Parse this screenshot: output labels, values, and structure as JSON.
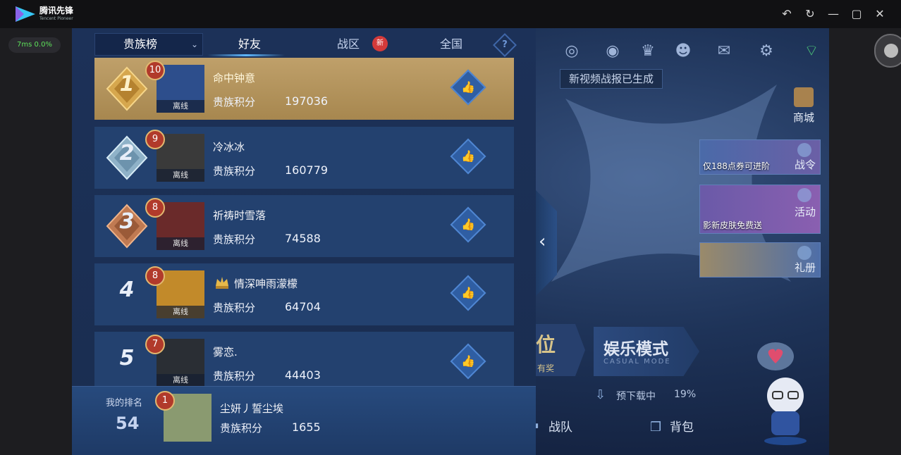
{
  "app": {
    "name": "腾讯先锋",
    "subtitle": "Tencent Pioneer"
  },
  "window_controls": {
    "back": "↶",
    "refresh": "↻",
    "minimize": "—",
    "maximize": "▢",
    "close": "✕"
  },
  "perf": {
    "text": "7ms  0.0%"
  },
  "tabs": {
    "dropdown": "贵族榜",
    "chevron": "⌄",
    "friends": "好友",
    "zone": "战区",
    "zone_badge": "新",
    "nation": "全国",
    "help": "?"
  },
  "leaderboard": {
    "rows": [
      {
        "rank": "1",
        "level": "10",
        "name": "命中钟意",
        "status": "离线",
        "score_label": "贵族积分",
        "score": "197036"
      },
      {
        "rank": "2",
        "level": "9",
        "name": "冷冰冰",
        "status": "离线",
        "score_label": "贵族积分",
        "score": "160779"
      },
      {
        "rank": "3",
        "level": "8",
        "name": "祈祷时雪落",
        "status": "离线",
        "score_label": "贵族积分",
        "score": "74588"
      },
      {
        "rank": "4",
        "level": "8",
        "name": "情深呻雨濛檬",
        "status": "离线",
        "score_label": "贵族积分",
        "score": "64704"
      },
      {
        "rank": "5",
        "level": "7",
        "name": "雾恋.",
        "status": "离线",
        "score_label": "贵族积分",
        "score": "44403"
      }
    ]
  },
  "my_rank": {
    "label": "我的排名",
    "rank": "54",
    "level": "1",
    "name": "尘妍丿誓尘埃",
    "score_label": "贵族积分",
    "score": "1655"
  },
  "right_ui": {
    "notify": "新视频战报已生成",
    "shop": "商城",
    "promo1_text": "仅188点券可进阶",
    "promo1_label": "战令",
    "promo2_text": "影新皮肤免费送",
    "promo2_label": "活动",
    "promo3_label": "礼册",
    "mode_left": "位",
    "mode_left_sub": "有奖",
    "mode_right": "娱乐模式",
    "mode_right_sub": "CASUAL MODE",
    "download_text": "预下载中",
    "download_pct": "19%",
    "team": "战队",
    "bag": "背包"
  },
  "colors": {
    "accent": "#5fb8ff",
    "gold_row": "#bfa06a",
    "row": "#23416f",
    "perf_green": "#5de05a"
  }
}
